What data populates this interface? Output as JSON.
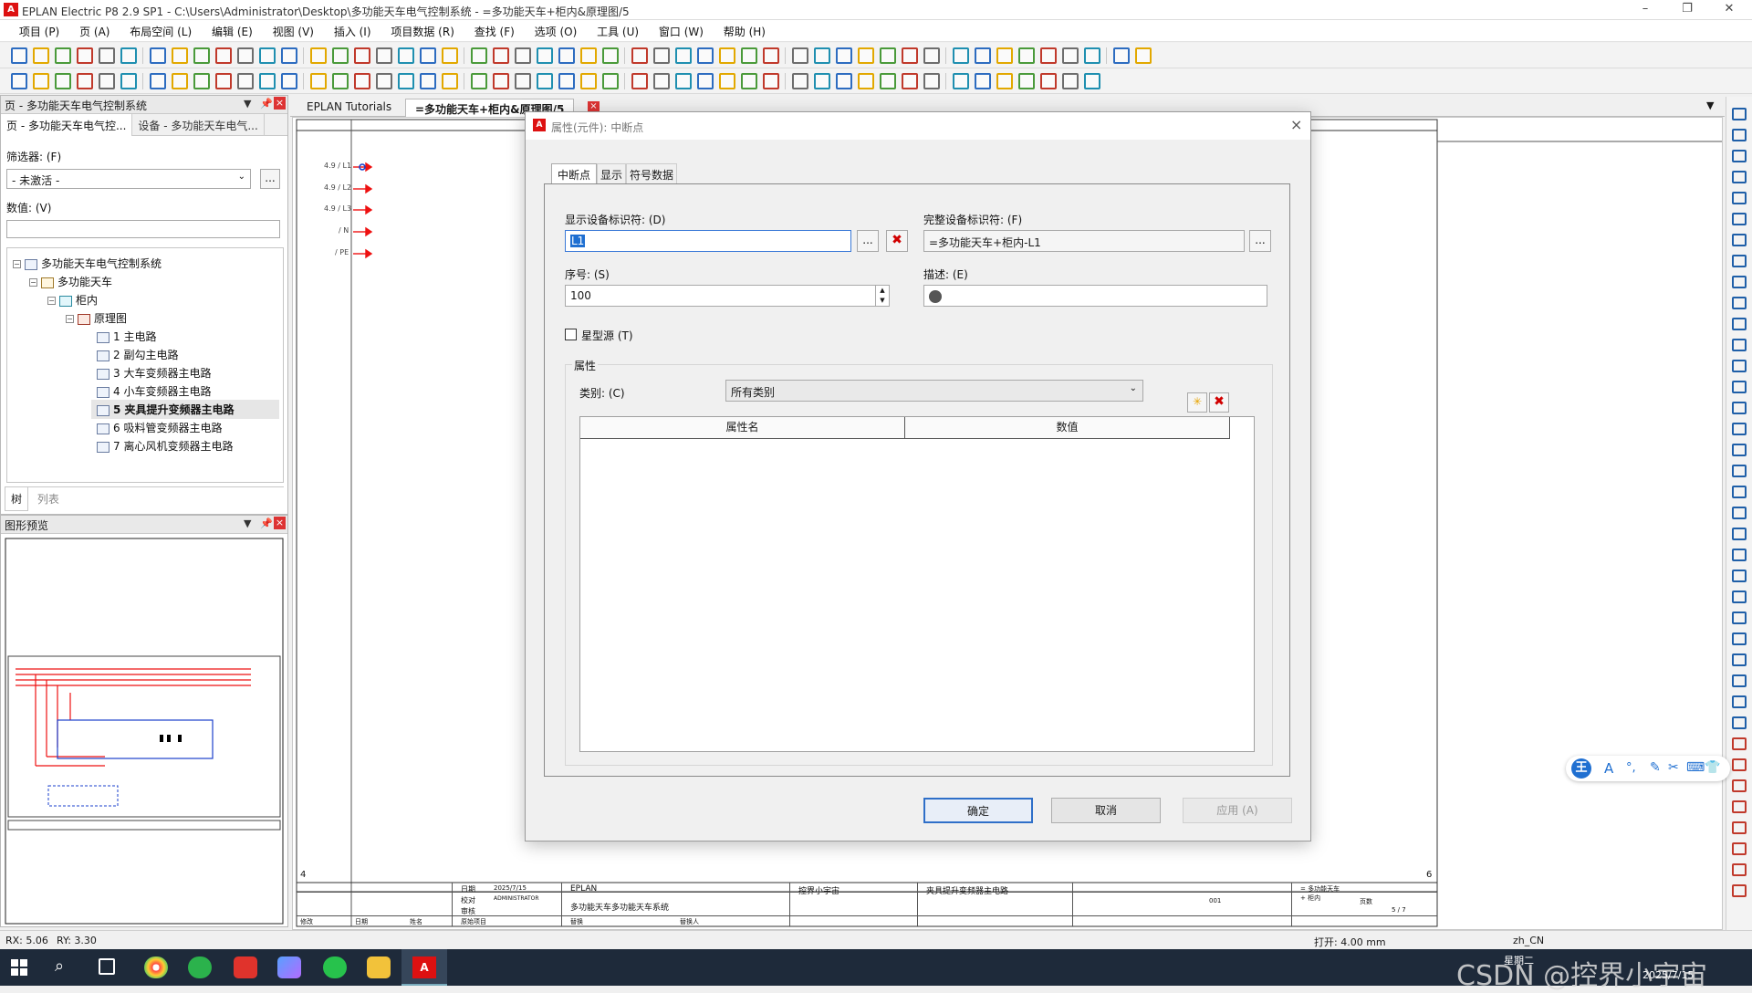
{
  "window": {
    "title": "EPLAN Electric P8 2.9 SP1 - C:\\Users\\Administrator\\Desktop\\多功能天车电气控制系统 - =多功能天车+柜内&原理图/5",
    "logo": "A"
  },
  "menu": [
    "项目 (P)",
    "页 (A)",
    "布局空间 (L)",
    "编辑 (E)",
    "视图 (V)",
    "插入 (I)",
    "项目数据 (R)",
    "查找 (F)",
    "选项 (O)",
    "工具 (U)",
    "窗口 (W)",
    "帮助 (H)"
  ],
  "page_panel": {
    "title": "页 - 多功能天车电气控制系统",
    "tabs": [
      "页 - 多功能天车电气控...",
      "设备 - 多功能天车电气..."
    ],
    "filter_label": "筛选器: (F)",
    "filter_value": "- 未激活 -",
    "value_label": "数值: (V)",
    "tree_root": "多功能天车电气控制系统",
    "tree_l1": "多功能天车",
    "tree_l2": "柜内",
    "tree_l3": "原理图",
    "pages": [
      "1 主电路",
      "2 副勾主电路",
      "3 大车变频器主电路",
      "4 小车变频器主电路",
      "5 夹具提升变频器主电路",
      "6 吸料管变频器主电路",
      "7 离心风机变频器主电路"
    ],
    "bottom_tabs": [
      "树",
      "列表"
    ]
  },
  "preview_panel": {
    "title": "图形预览"
  },
  "doc_tabs": [
    "EPLAN Tutorials",
    "=多功能天车+柜内&原理图/5"
  ],
  "drawing": {
    "signals": [
      "4.9 / L1",
      "4.9 / L2",
      "4.9 / L3",
      "/ N",
      "/ PE"
    ],
    "col_left": "4",
    "col_right": "6",
    "titleblock": {
      "date_label": "日期",
      "date": "2025/7/15",
      "editor_label": "校对",
      "editor": "ADMINISTRATOR",
      "review_label": "审核",
      "company": "EPLAN",
      "project": "多功能天车多功能天车系统",
      "designer_label": "控界小宇宙",
      "page_desc": "夹具提升变频器主电路",
      "func": "= 多功能天车",
      "loc": "+ 柜内",
      "page_no": "5 / 7",
      "modify": "修改",
      "date2": "日期",
      "name": "姓名",
      "orig": "原始项目",
      "replace": "替换",
      "replaced": "替换人",
      "sheet_code": "001",
      "pages_label": "页数"
    }
  },
  "dialog": {
    "title": "属性(元件): 中断点",
    "tabs": [
      "中断点",
      "显示",
      "符号数据"
    ],
    "display_dt_label": "显示设备标识符: (D)",
    "display_dt_value": "L1",
    "full_dt_label": "完整设备标识符: (F)",
    "full_dt_value": "=多功能天车+柜内-L1",
    "seq_label": "序号: (S)",
    "seq_value": "100",
    "desc_label": "描述: (E)",
    "desc_value": "",
    "star_label": "星型源 (T)",
    "star_checked": false,
    "props_group": "属性",
    "category_label": "类别: (C)",
    "category_value": "所有类别",
    "col_name": "属性名",
    "col_value": "数值",
    "ok": "确定",
    "cancel": "取消",
    "apply": "应用 (A)",
    "dots": "...",
    "close": "×"
  },
  "status": {
    "rx": "RX: 5.06",
    "ry": "RY: 3.30",
    "open": "打开: 4.00 mm",
    "lang": "zh_CN"
  },
  "taskbar": {
    "weekday": "星期二",
    "date": "2025/7/15",
    "watermark": "CSDN @控界小宇宙"
  },
  "ime": {
    "brand": "王",
    "glyph_a": "A"
  }
}
